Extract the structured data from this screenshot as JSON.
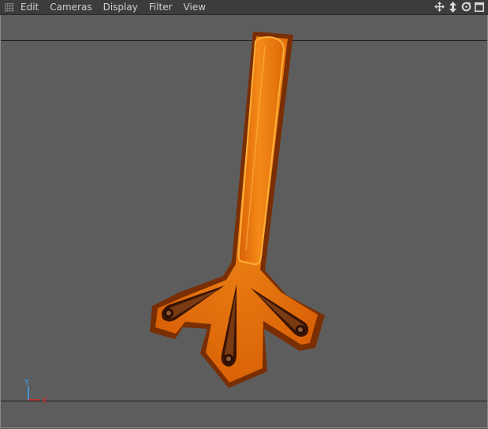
{
  "menubar": {
    "items": [
      {
        "label": "Edit"
      },
      {
        "label": "Cameras"
      },
      {
        "label": "Display"
      },
      {
        "label": "Filter"
      },
      {
        "label": "View"
      }
    ],
    "nav_icons": [
      "move-icon",
      "zoom-icon",
      "rotate-icon",
      "maximize-icon"
    ]
  },
  "axis": {
    "y_label": "Y",
    "x_label": "X",
    "y_color": "#3fa8ff",
    "x_color": "#e02a2a"
  },
  "colors": {
    "background": "#5d5d5d",
    "menubar": "#3c3c3c",
    "object_fill": "#f07a0c",
    "object_edge": "#7a2e04",
    "object_highlight": "#ffb13a"
  }
}
